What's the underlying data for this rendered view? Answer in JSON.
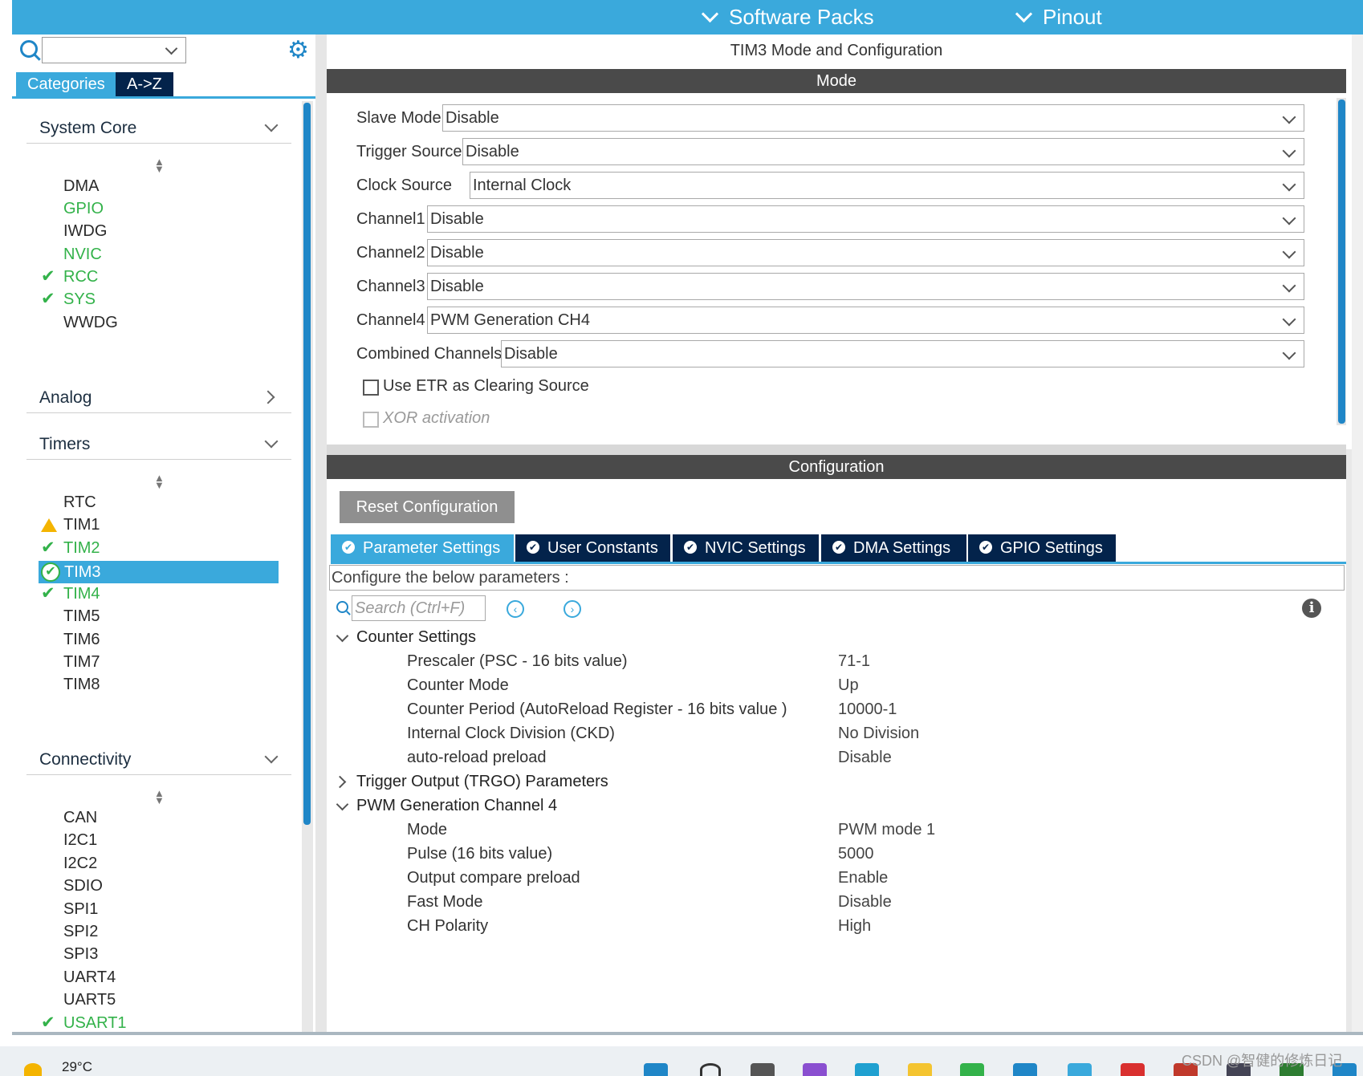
{
  "topbar": {
    "software_packs": "Software Packs",
    "pinout": "Pinout"
  },
  "sidebar": {
    "tabs": [
      "Categories",
      "A->Z"
    ],
    "categories": [
      {
        "label": "System Core",
        "expanded": true,
        "items": [
          {
            "label": "DMA",
            "status": "none"
          },
          {
            "label": "GPIO",
            "status": "configured"
          },
          {
            "label": "IWDG",
            "status": "none"
          },
          {
            "label": "NVIC",
            "status": "configured"
          },
          {
            "label": "RCC",
            "status": "ok"
          },
          {
            "label": "SYS",
            "status": "ok"
          },
          {
            "label": "WWDG",
            "status": "none"
          }
        ]
      },
      {
        "label": "Analog",
        "expanded": false
      },
      {
        "label": "Timers",
        "expanded": true,
        "items": [
          {
            "label": "RTC",
            "status": "none"
          },
          {
            "label": "TIM1",
            "status": "warning"
          },
          {
            "label": "TIM2",
            "status": "ok"
          },
          {
            "label": "TIM3",
            "status": "selected"
          },
          {
            "label": "TIM4",
            "status": "ok"
          },
          {
            "label": "TIM5",
            "status": "none"
          },
          {
            "label": "TIM6",
            "status": "none"
          },
          {
            "label": "TIM7",
            "status": "none"
          },
          {
            "label": "TIM8",
            "status": "none"
          }
        ]
      },
      {
        "label": "Connectivity",
        "expanded": true,
        "items": [
          {
            "label": "CAN",
            "status": "none"
          },
          {
            "label": "I2C1",
            "status": "none"
          },
          {
            "label": "I2C2",
            "status": "none"
          },
          {
            "label": "SDIO",
            "status": "none"
          },
          {
            "label": "SPI1",
            "status": "none"
          },
          {
            "label": "SPI2",
            "status": "none"
          },
          {
            "label": "SPI3",
            "status": "none"
          },
          {
            "label": "UART4",
            "status": "none"
          },
          {
            "label": "UART5",
            "status": "none"
          },
          {
            "label": "USART1",
            "status": "ok"
          }
        ]
      }
    ]
  },
  "main": {
    "title": "TIM3 Mode and Configuration",
    "mode_header": "Mode",
    "mode_fields": [
      {
        "label": "Slave Mode",
        "value": "Disable"
      },
      {
        "label": "Trigger Source",
        "value": "Disable"
      },
      {
        "label": "Clock Source",
        "value": "Internal Clock"
      },
      {
        "label": "Channel1",
        "value": "Disable"
      },
      {
        "label": "Channel2",
        "value": "Disable"
      },
      {
        "label": "Channel3",
        "value": "Disable"
      },
      {
        "label": "Channel4",
        "value": "PWM Generation CH4"
      },
      {
        "label": "Combined Channels",
        "value": "Disable"
      }
    ],
    "checkboxes": [
      {
        "label": "Use ETR as Clearing Source",
        "checked": false,
        "enabled": true
      },
      {
        "label": "XOR activation",
        "checked": false,
        "enabled": false
      }
    ],
    "config_header": "Configuration",
    "reset_button": "Reset Configuration",
    "config_tabs": [
      "Parameter Settings",
      "User Constants",
      "NVIC Settings",
      "DMA Settings",
      "GPIO Settings"
    ],
    "configure_hint": "Configure the below parameters :",
    "search_placeholder": "Search (Ctrl+F)",
    "groups": [
      {
        "label": "Counter Settings",
        "expanded": true,
        "params": [
          {
            "name": "Prescaler (PSC - 16 bits value)",
            "value": "71-1"
          },
          {
            "name": "Counter Mode",
            "value": "Up"
          },
          {
            "name": "Counter Period (AutoReload Register - 16 bits value )",
            "value": "10000-1"
          },
          {
            "name": "Internal Clock Division (CKD)",
            "value": "No Division"
          },
          {
            "name": "auto-reload preload",
            "value": "Disable"
          }
        ]
      },
      {
        "label": "Trigger Output (TRGO) Parameters",
        "expanded": false
      },
      {
        "label": "PWM Generation Channel 4",
        "expanded": true,
        "params": [
          {
            "name": "Mode",
            "value": "PWM mode 1"
          },
          {
            "name": "Pulse (16 bits value)",
            "value": "5000"
          },
          {
            "name": "Output compare preload",
            "value": "Enable"
          },
          {
            "name": "Fast Mode",
            "value": "Disable"
          },
          {
            "name": "CH Polarity",
            "value": "High"
          }
        ]
      }
    ]
  },
  "taskbar": {
    "temperature": "29°C",
    "watermark": "CSDN @智健的修炼日记"
  },
  "colors": {
    "accent": "#3aa9dc",
    "navy": "#03234b",
    "green": "#33b24a",
    "warning": "#f4b400"
  }
}
